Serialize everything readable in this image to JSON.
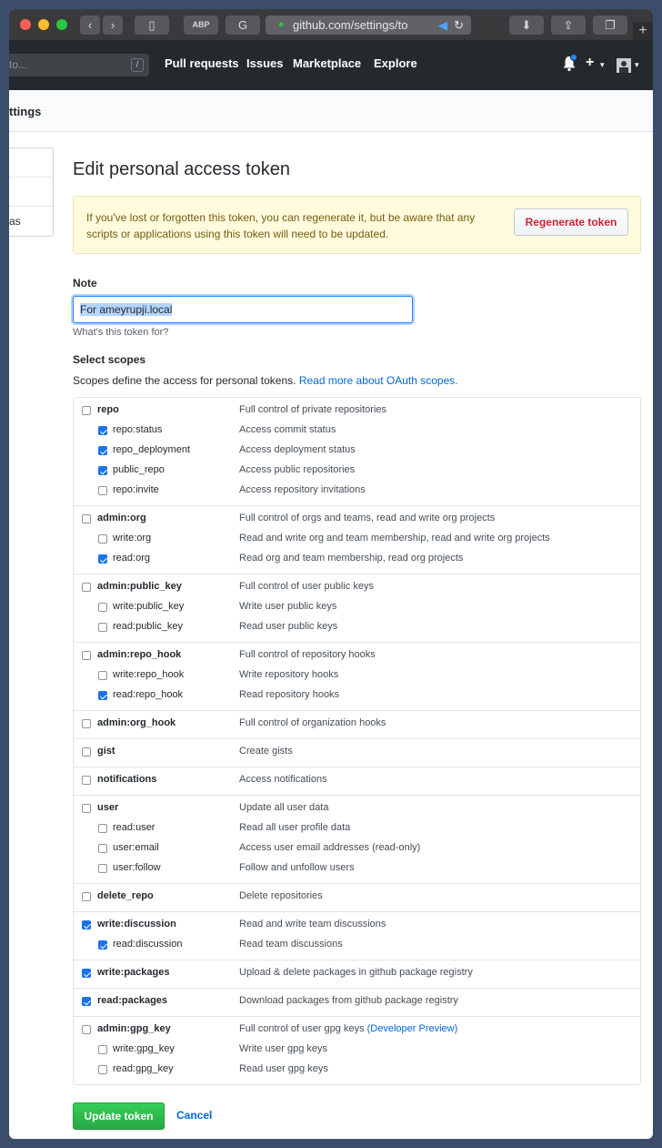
{
  "browser": {
    "url": "github.com/settings/to",
    "new_tab_label": "+"
  },
  "header": {
    "search_placeholder": "to...",
    "search_hint": "/",
    "nav": [
      "Pull requests",
      "Issues",
      "Marketplace",
      "Explore"
    ]
  },
  "subheader": {
    "title": "ttings"
  },
  "sidebar": {
    "items": [
      "",
      "",
      "as"
    ]
  },
  "page": {
    "title": "Edit personal access token",
    "flash": "If you've lost or forgotten this token, you can regenerate it, but be aware that any scripts or applications using this token will need to be updated.",
    "regenerate_label": "Regenerate token",
    "note_label": "Note",
    "note_value": "For ameyrupji.local",
    "note_hint": "What's this token for?",
    "scopes_label": "Select scopes",
    "scopes_desc": "Scopes define the access for personal tokens.",
    "scopes_link": "Read more about OAuth scopes.",
    "update_label": "Update token",
    "cancel_label": "Cancel"
  },
  "scopes": [
    {
      "name": "repo",
      "desc": "Full control of private repositories",
      "checked": false,
      "children": [
        {
          "name": "repo:status",
          "desc": "Access commit status",
          "checked": true
        },
        {
          "name": "repo_deployment",
          "desc": "Access deployment status",
          "checked": true
        },
        {
          "name": "public_repo",
          "desc": "Access public repositories",
          "checked": true
        },
        {
          "name": "repo:invite",
          "desc": "Access repository invitations",
          "checked": false
        }
      ]
    },
    {
      "name": "admin:org",
      "desc": "Full control of orgs and teams, read and write org projects",
      "checked": false,
      "children": [
        {
          "name": "write:org",
          "desc": "Read and write org and team membership, read and write org projects",
          "checked": false
        },
        {
          "name": "read:org",
          "desc": "Read org and team membership, read org projects",
          "checked": true
        }
      ]
    },
    {
      "name": "admin:public_key",
      "desc": "Full control of user public keys",
      "checked": false,
      "children": [
        {
          "name": "write:public_key",
          "desc": "Write user public keys",
          "checked": false
        },
        {
          "name": "read:public_key",
          "desc": "Read user public keys",
          "checked": false
        }
      ]
    },
    {
      "name": "admin:repo_hook",
      "desc": "Full control of repository hooks",
      "checked": false,
      "children": [
        {
          "name": "write:repo_hook",
          "desc": "Write repository hooks",
          "checked": false
        },
        {
          "name": "read:repo_hook",
          "desc": "Read repository hooks",
          "checked": true
        }
      ]
    },
    {
      "name": "admin:org_hook",
      "desc": "Full control of organization hooks",
      "checked": false,
      "children": []
    },
    {
      "name": "gist",
      "desc": "Create gists",
      "checked": false,
      "children": []
    },
    {
      "name": "notifications",
      "desc": "Access notifications",
      "checked": false,
      "children": []
    },
    {
      "name": "user",
      "desc": "Update all user data",
      "checked": false,
      "children": [
        {
          "name": "read:user",
          "desc": "Read all user profile data",
          "checked": false
        },
        {
          "name": "user:email",
          "desc": "Access user email addresses (read-only)",
          "checked": false
        },
        {
          "name": "user:follow",
          "desc": "Follow and unfollow users",
          "checked": false
        }
      ]
    },
    {
      "name": "delete_repo",
      "desc": "Delete repositories",
      "checked": false,
      "children": []
    },
    {
      "name": "write:discussion",
      "desc": "Read and write team discussions",
      "checked": true,
      "children": [
        {
          "name": "read:discussion",
          "desc": "Read team discussions",
          "checked": true
        }
      ]
    },
    {
      "name": "write:packages",
      "desc": "Upload & delete packages in github package registry",
      "checked": true,
      "children": []
    },
    {
      "name": "read:packages",
      "desc": "Download packages from github package registry",
      "checked": true,
      "children": []
    },
    {
      "name": "admin:gpg_key",
      "desc": "Full control of user gpg keys",
      "desc_extra": "(Developer Preview)",
      "checked": false,
      "children": [
        {
          "name": "write:gpg_key",
          "desc": "Write user gpg keys",
          "checked": false
        },
        {
          "name": "read:gpg_key",
          "desc": "Read user gpg keys",
          "checked": false
        }
      ]
    }
  ]
}
